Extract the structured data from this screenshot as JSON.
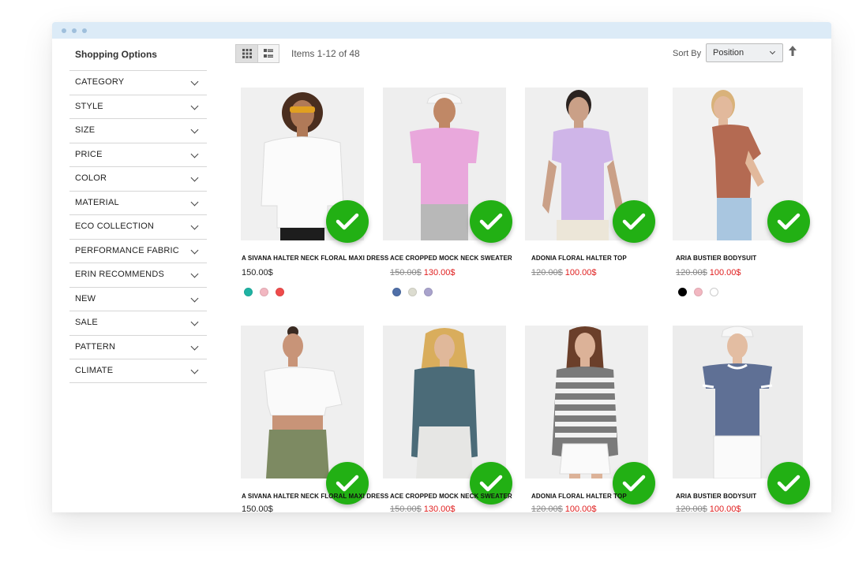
{
  "sidebar": {
    "title": "Shopping Options",
    "filters": [
      "CATEGORY",
      "STYLE",
      "SIZE",
      "PRICE",
      "COLOR",
      "MATERIAL",
      "ECO COLLECTION",
      "PERFORMANCE FABRIC",
      "ERIN RECOMMENDS",
      "NEW",
      "SALE",
      "PATTERN",
      "CLIMATE"
    ]
  },
  "toolbar": {
    "items_count": "Items 1-12 of 48",
    "sort_label": "Sort By",
    "sort_value": "Position",
    "view_modes": [
      "grid-icon",
      "list-icon"
    ]
  },
  "products": [
    {
      "name": "A SIVANA HALTER NECK FLORAL MAXI DRESS",
      "price": "150.00$",
      "old_price": "",
      "swatches": [
        "#1fb3a3",
        "#f2b7c1",
        "#ef4b4b"
      ]
    },
    {
      "name": "ACE CROPPED MOCK NECK SWEATER",
      "price": "130.00$",
      "old_price": "150.00$",
      "swatches": [
        "#4f6fa8",
        "#dcdcd0",
        "#a9a3cc"
      ]
    },
    {
      "name": "ADONIA FLORAL HALTER TOP",
      "price": "100.00$",
      "old_price": "120.00$",
      "swatches": []
    },
    {
      "name": "ARIA BUSTIER BODYSUIT",
      "price": "100.00$",
      "old_price": "120.00$",
      "swatches": [
        "#000000",
        "#f2b7c1",
        "#ffffff"
      ]
    },
    {
      "name": "A SIVANA HALTER NECK FLORAL MAXI DRESS",
      "price": "150.00$",
      "old_price": "",
      "swatches": []
    },
    {
      "name": "ACE CROPPED MOCK NECK SWEATER",
      "price": "130.00$",
      "old_price": "150.00$",
      "swatches": []
    },
    {
      "name": "ADONIA FLORAL HALTER TOP",
      "price": "100.00$",
      "old_price": "120.00$",
      "swatches": []
    },
    {
      "name": "ARIA BUSTIER BODYSUIT",
      "price": "100.00$",
      "old_price": "120.00$",
      "swatches": []
    }
  ],
  "colors": {
    "check_green": "#22b014",
    "sale_red": "#e02020",
    "titlebar": "#dcebf7"
  }
}
